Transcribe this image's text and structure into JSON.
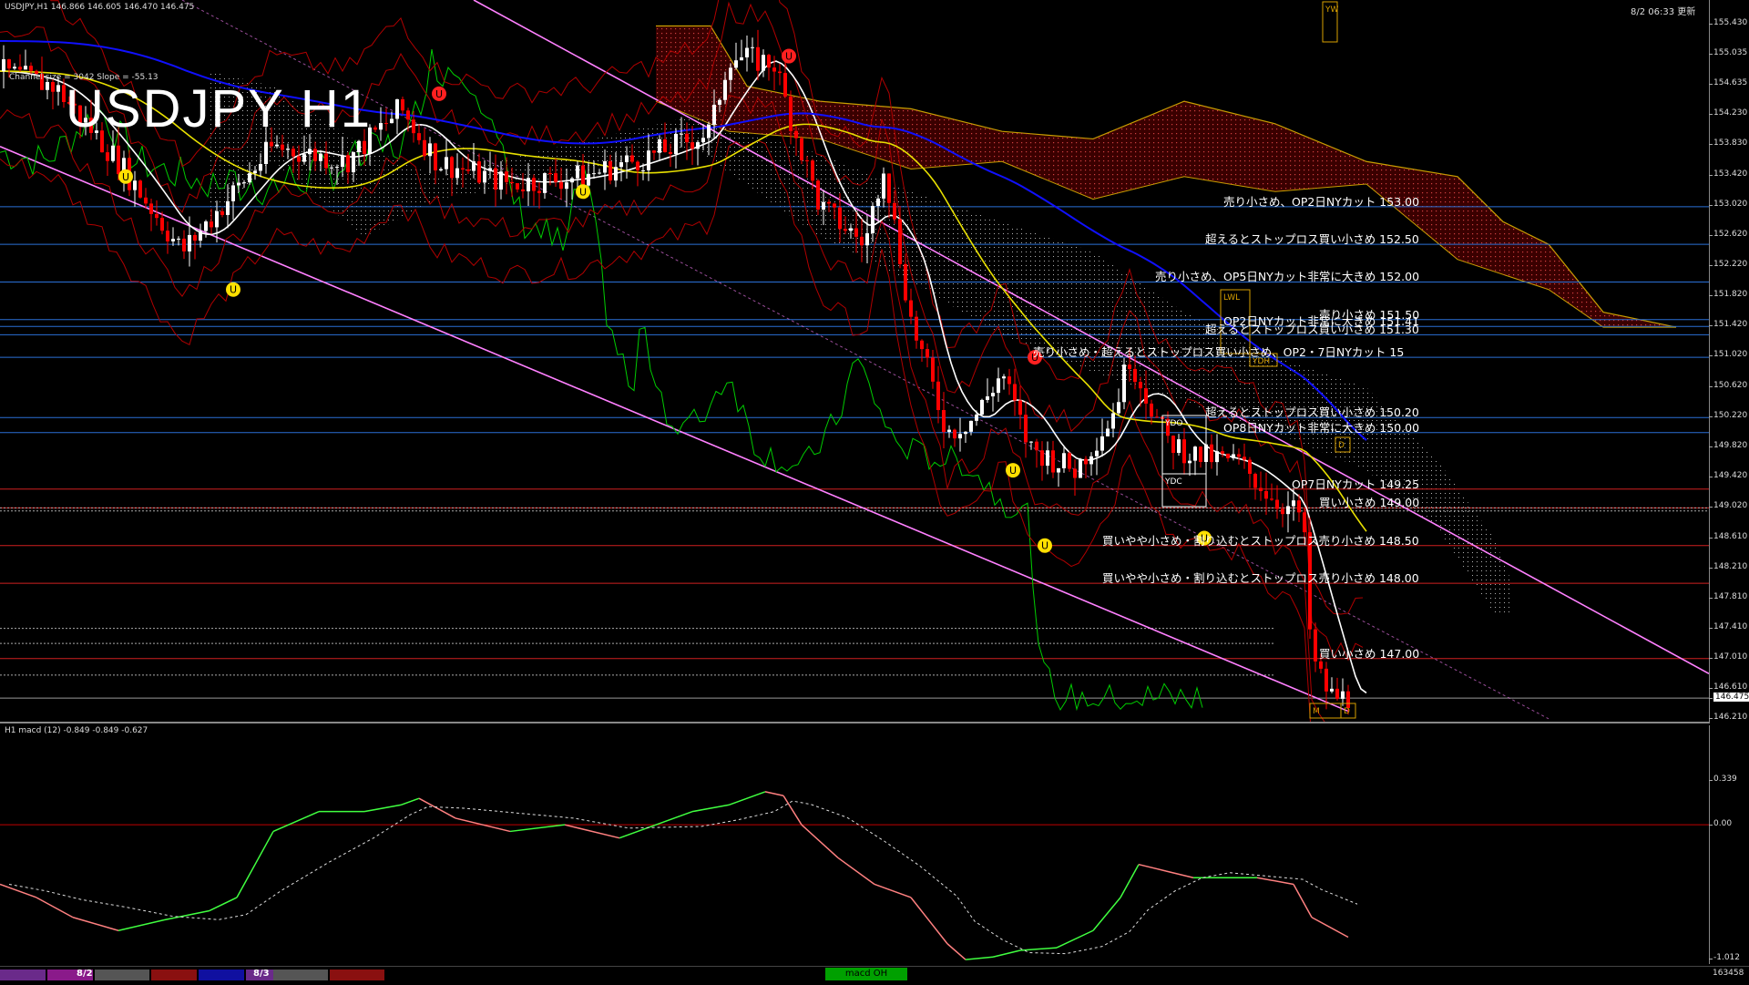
{
  "header": {
    "chart_title": "USDJPY,H1  146.866 146.605 146.470 146.475",
    "channel_info": "Channel size = 3042 Slope = -55.13",
    "symbol_label": "USDJPY H1",
    "updated": "8/2 06:33 更新"
  },
  "price_axis": [
    "155.430",
    "155.035",
    "154.635",
    "154.230",
    "153.830",
    "153.420",
    "153.020",
    "152.620",
    "152.220",
    "151.820",
    "151.420",
    "151.020",
    "150.620",
    "150.220",
    "149.820",
    "149.420",
    "149.020",
    "148.610",
    "148.210",
    "147.810",
    "147.410",
    "147.010",
    "146.610",
    "146.475",
    "146.210"
  ],
  "current_price": "146.475",
  "macd": {
    "header": "H1  macd (12) -0.849 -0.849 -0.627",
    "axis": [
      "0.339",
      "0.00",
      "-1.012"
    ]
  },
  "levels": [
    {
      "price": 153.0,
      "color": "#2a6fd6",
      "label": "売り小さめ、OP2日NYカット 153.00"
    },
    {
      "price": 152.5,
      "color": "#2a6fd6",
      "label": "超えるとストップロス買い小さめ 152.50"
    },
    {
      "price": 152.0,
      "color": "#2a6fd6",
      "label": "売り小さめ、OP5日NYカット非常に大きめ 152.00"
    },
    {
      "price": 151.5,
      "color": "#2a6fd6",
      "label": "売り小さめ 151.50"
    },
    {
      "price": 151.41,
      "color": "#2a6fd6",
      "label": "OP2日NYカット非常に大きめ 151.41"
    },
    {
      "price": 151.3,
      "color": "#2a6fd6",
      "label": "超えるとストップロス買い小さめ 151.30"
    },
    {
      "price": 151.0,
      "color": "#2a6fd6",
      "label": "売り小さめ・超えるとストップロス買い小さめ、OP2・7日NYカット 15"
    },
    {
      "price": 150.2,
      "color": "#2a6fd6",
      "label": "超えるとストップロス買い小さめ 150.20"
    },
    {
      "price": 150.0,
      "color": "#2a6fd6",
      "label": "OP8日NYカット非常に大きめ 150.00"
    },
    {
      "price": 149.25,
      "color": "#d02020",
      "label": "OP7日NYカット 149.25"
    },
    {
      "price": 149.0,
      "color": "#d02020",
      "label": "買い小さめ 149.00"
    },
    {
      "price": 148.5,
      "color": "#d02020",
      "label": "買いやや小さめ・割り込むとストップロス売り小さめ 148.50"
    },
    {
      "price": 148.0,
      "color": "#d02020",
      "label": "買いやや小さめ・割り込むとストップロス売り小さめ 148.00"
    },
    {
      "price": 147.0,
      "color": "#d02020",
      "label": "買い小さめ 147.00"
    }
  ],
  "markers": {
    "lwl": "LWL",
    "ydh": "YDH",
    "ydo": "YDO",
    "ydc": "YDC",
    "wk": "W",
    "d": "D",
    "m": "M",
    "yw": "YW"
  },
  "bottom_bar": {
    "date1": "8/2",
    "date2": "8/3",
    "macd_tab": "macd OH",
    "right_value": "163458"
  },
  "colors": {
    "bg": "#000000",
    "bull": "#ffffff",
    "bear": "#ff0000",
    "ma_white": "#ffffff",
    "ma_yellow": "#e8e000",
    "ma_blue": "#1010ff",
    "channel": "#ff80ff",
    "chikou": "#00cc00",
    "kumo": "#cc0000",
    "macd_up": "#40ff40",
    "macd_down": "#ff8080"
  }
}
